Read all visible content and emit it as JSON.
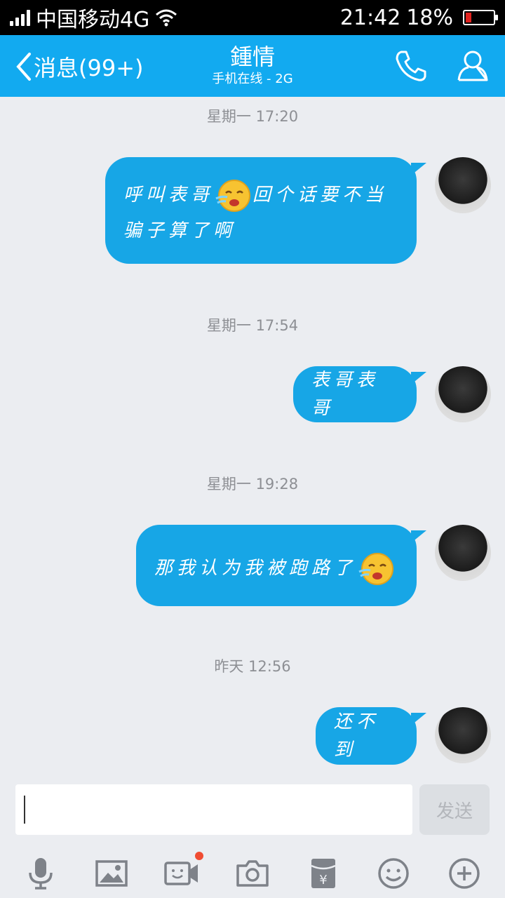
{
  "status_bar": {
    "carrier": "中国移动4G",
    "time": "21:42",
    "battery": "18%",
    "battery_level": 0.18
  },
  "header": {
    "back_label": "消息(99+)",
    "contact_name": "鍾情",
    "contact_status": "手机在线 - 2G",
    "call_icon": "phone-icon",
    "profile_icon": "user-icon"
  },
  "messages": [
    {
      "timestamp": "星期一 17:20",
      "text_before": "呼叫表哥",
      "emoji": "crying-laughing",
      "text_after": "回个话要不当骗子算了啊"
    },
    {
      "timestamp": "星期一 17:54",
      "text": "表哥表哥"
    },
    {
      "timestamp": "星期一 19:28",
      "text_before": "那我认为我被跑路了",
      "emoji": "crying-laughing"
    },
    {
      "timestamp": "昨天 12:56",
      "text": "还不到"
    }
  ],
  "input": {
    "value": "",
    "send_label": "发送"
  },
  "toolbar": {
    "items": [
      "microphone-icon",
      "image-icon",
      "video-call-icon",
      "camera-icon",
      "red-packet-icon",
      "emoji-icon",
      "plus-icon"
    ]
  },
  "colors": {
    "header": "#12aaf0",
    "bubble": "#17a6e6",
    "background": "#ebedf1",
    "badge": "#f04c32"
  }
}
